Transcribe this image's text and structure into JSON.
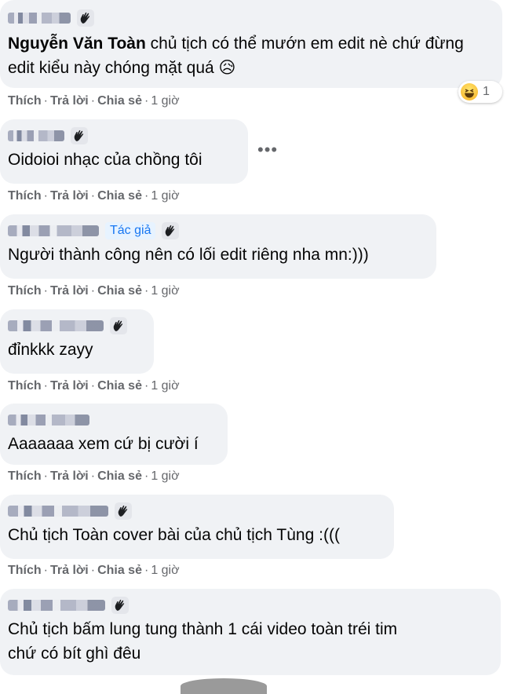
{
  "comments": [
    {
      "author": "Nguyễn Văn Toàn",
      "author_prefix": "",
      "text": "chủ tịch có thể mướn em edit nè chứ đừng edit kiểu này chóng mặt quá 😥",
      "reaction_count": "1"
    },
    {
      "text": "Oidoioi nhạc của chồng tôi"
    },
    {
      "author_tag": "Tác giả",
      "text": "Người thành công nên có lối edit riêng nha mn:)))"
    },
    {
      "text": "đỉnkkk zayy"
    },
    {
      "text": "Aaaaaaa xem cứ bị cười í"
    },
    {
      "text": "Chủ tịch Toàn cover bài của chủ tịch Tùng :((("
    },
    {
      "text_line1": "Chủ tịch bấm lung tung thành 1 cái video toàn tréi tim",
      "text_line2": "chứ có bít ghì đêu"
    }
  ],
  "actions": {
    "like": "Thích",
    "reply": "Trả lời",
    "share": "Chia sẻ",
    "time": "1 giờ",
    "dot": "·"
  },
  "more_label": "•••",
  "colors": {
    "bubble": "#f0f2f5",
    "meta": "#65676b",
    "accent": "#1877f2"
  },
  "icons": {
    "badge": "waving-hand-icon",
    "reaction": "haha-emoji-icon",
    "more": "more-options-icon"
  }
}
